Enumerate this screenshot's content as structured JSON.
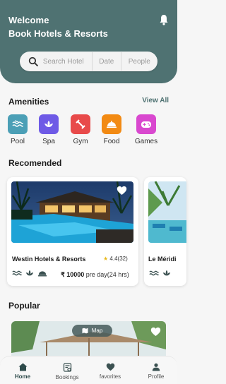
{
  "header": {
    "welcome": "Welcome",
    "subtitle": "Book Hotels & Resorts",
    "bell_icon": "bell-icon"
  },
  "search": {
    "placeholder": "Search Hotel",
    "date": "Date",
    "people": "People"
  },
  "amenities": {
    "title": "Amenities",
    "view_all": "View All",
    "items": [
      {
        "label": "Pool",
        "icon": "pool-icon",
        "color": "#4b9fb6"
      },
      {
        "label": "Spa",
        "icon": "spa-icon",
        "color": "#6e5ae6"
      },
      {
        "label": "Gym",
        "icon": "gym-icon",
        "color": "#e84a4a"
      },
      {
        "label": "Food",
        "icon": "food-icon",
        "color": "#f28a13"
      },
      {
        "label": "Games",
        "icon": "games-icon",
        "color": "#d948cf"
      }
    ]
  },
  "recommended": {
    "title": "Recomended",
    "cards": [
      {
        "name": "Westin Hotels & Resorts",
        "rating": "4.4",
        "reviews": "(32)",
        "price": "₹ 10000",
        "price_unit": "pre day(24 hrs)"
      },
      {
        "name": "Le Méridi"
      }
    ]
  },
  "popular": {
    "title": "Popular",
    "map_label": "Map"
  },
  "nav": {
    "items": [
      {
        "label": "Home",
        "icon": "home-icon"
      },
      {
        "label": "Bookings",
        "icon": "bookings-icon"
      },
      {
        "label": "favorites",
        "icon": "heart-icon"
      },
      {
        "label": "Profile",
        "icon": "profile-icon"
      }
    ]
  },
  "colors": {
    "brand": "#4f7272"
  }
}
